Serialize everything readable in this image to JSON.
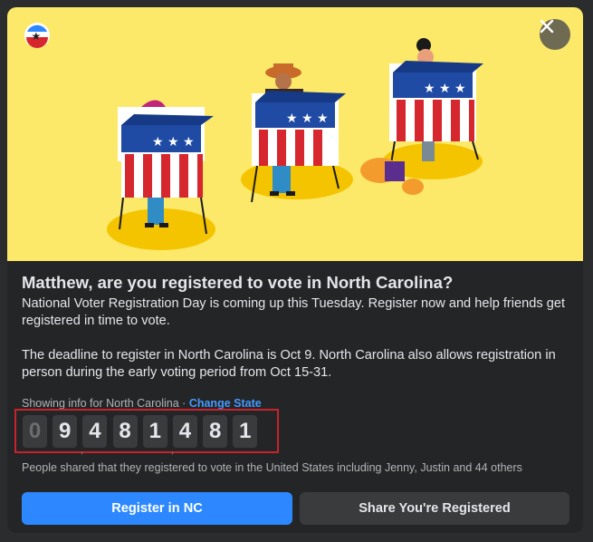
{
  "headline": "Matthew, are you registered to vote in North Carolina?",
  "paragraphs": [
    "National Voter Registration Day is coming up this Tuesday. Register now and help friends get registered in time to vote.",
    "The deadline to register in North Carolina is Oct 9. North Carolina also allows registration in person during the early voting period from Oct 15-31."
  ],
  "showing_info": "Showing info for North Carolina",
  "separator": " · ",
  "change_state": "Change State",
  "counter": {
    "digits": [
      "0",
      "9",
      "4",
      "8",
      "1",
      "4",
      "8",
      "1"
    ],
    "group_separators": [
      ",",
      ","
    ]
  },
  "shared_text": "People shared that they registered to vote in the United States including Jenny, Justin and 44 others",
  "buttons": {
    "register": "Register in NC",
    "share": "Share You're Registered"
  },
  "colors": {
    "hero_background": "#fce96a",
    "primary_button": "#2d88ff",
    "highlight_border": "#c8232c",
    "link": "#4599ff"
  },
  "icons": {
    "close": "close-icon",
    "badge": "voting-star-badge-icon"
  }
}
